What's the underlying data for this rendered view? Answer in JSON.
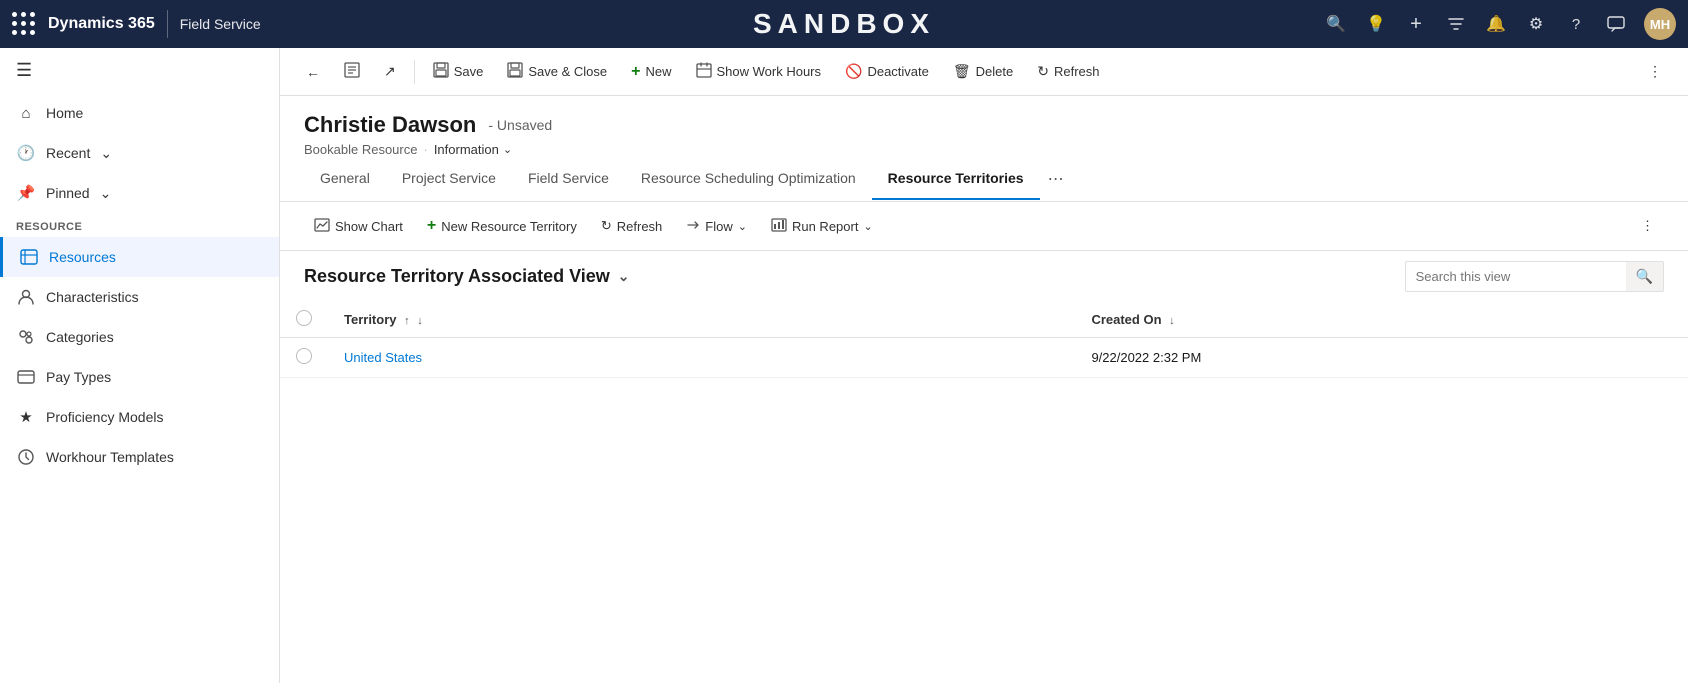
{
  "topnav": {
    "brand": "Dynamics 365",
    "app_name": "Field Service",
    "sandbox_title": "SANDBOX",
    "icons": {
      "search": "🔍",
      "bulb": "💡",
      "plus": "+",
      "filter": "⊤",
      "bell": "🔔",
      "settings": "⚙",
      "help": "?",
      "chat": "💬"
    },
    "avatar": "MH"
  },
  "toolbar": {
    "back_label": "←",
    "record_icon": "📄",
    "open_icon": "↗",
    "save_label": "Save",
    "save_close_label": "Save & Close",
    "new_label": "New",
    "show_work_hours_label": "Show Work Hours",
    "deactivate_label": "Deactivate",
    "delete_label": "Delete",
    "refresh_label": "Refresh",
    "more_label": "⋮"
  },
  "record": {
    "name": "Christie Dawson",
    "unsaved": "- Unsaved",
    "entity": "Bookable Resource",
    "separator": "·",
    "form_selector": "Information"
  },
  "tabs": [
    {
      "id": "general",
      "label": "General"
    },
    {
      "id": "project-service",
      "label": "Project Service"
    },
    {
      "id": "field-service",
      "label": "Field Service"
    },
    {
      "id": "resource-scheduling",
      "label": "Resource Scheduling Optimization"
    },
    {
      "id": "resource-territories",
      "label": "Resource Territories",
      "active": true
    }
  ],
  "sub_toolbar": {
    "show_chart_label": "Show Chart",
    "new_resource_label": "New Resource Territory",
    "refresh_label": "Refresh",
    "flow_label": "Flow",
    "run_report_label": "Run Report",
    "more_label": "⋮"
  },
  "table": {
    "view_title": "Resource Territory Associated View",
    "search_placeholder": "Search this view",
    "columns": [
      {
        "id": "territory",
        "label": "Territory",
        "sortable": true
      },
      {
        "id": "created_on",
        "label": "Created On",
        "sortable": true
      }
    ],
    "rows": [
      {
        "territory": "United States",
        "created_on": "9/22/2022 2:32 PM"
      }
    ]
  },
  "sidebar": {
    "section_label": "Resource",
    "items": [
      {
        "id": "home",
        "label": "Home",
        "icon": "🏠",
        "type": "link"
      },
      {
        "id": "recent",
        "label": "Recent",
        "icon": "🕐",
        "type": "group",
        "chevron": "∨"
      },
      {
        "id": "pinned",
        "label": "Pinned",
        "icon": "📌",
        "type": "group",
        "chevron": "∨"
      },
      {
        "id": "resources",
        "label": "Resources",
        "icon": "👤",
        "active": true
      },
      {
        "id": "characteristics",
        "label": "Characteristics",
        "icon": "📊"
      },
      {
        "id": "categories",
        "label": "Categories",
        "icon": "👥"
      },
      {
        "id": "pay-types",
        "label": "Pay Types",
        "icon": "📋"
      },
      {
        "id": "proficiency-models",
        "label": "Proficiency Models",
        "icon": "⭐"
      },
      {
        "id": "workhour-templates",
        "label": "Workhour Templates",
        "icon": "⏱"
      }
    ]
  }
}
